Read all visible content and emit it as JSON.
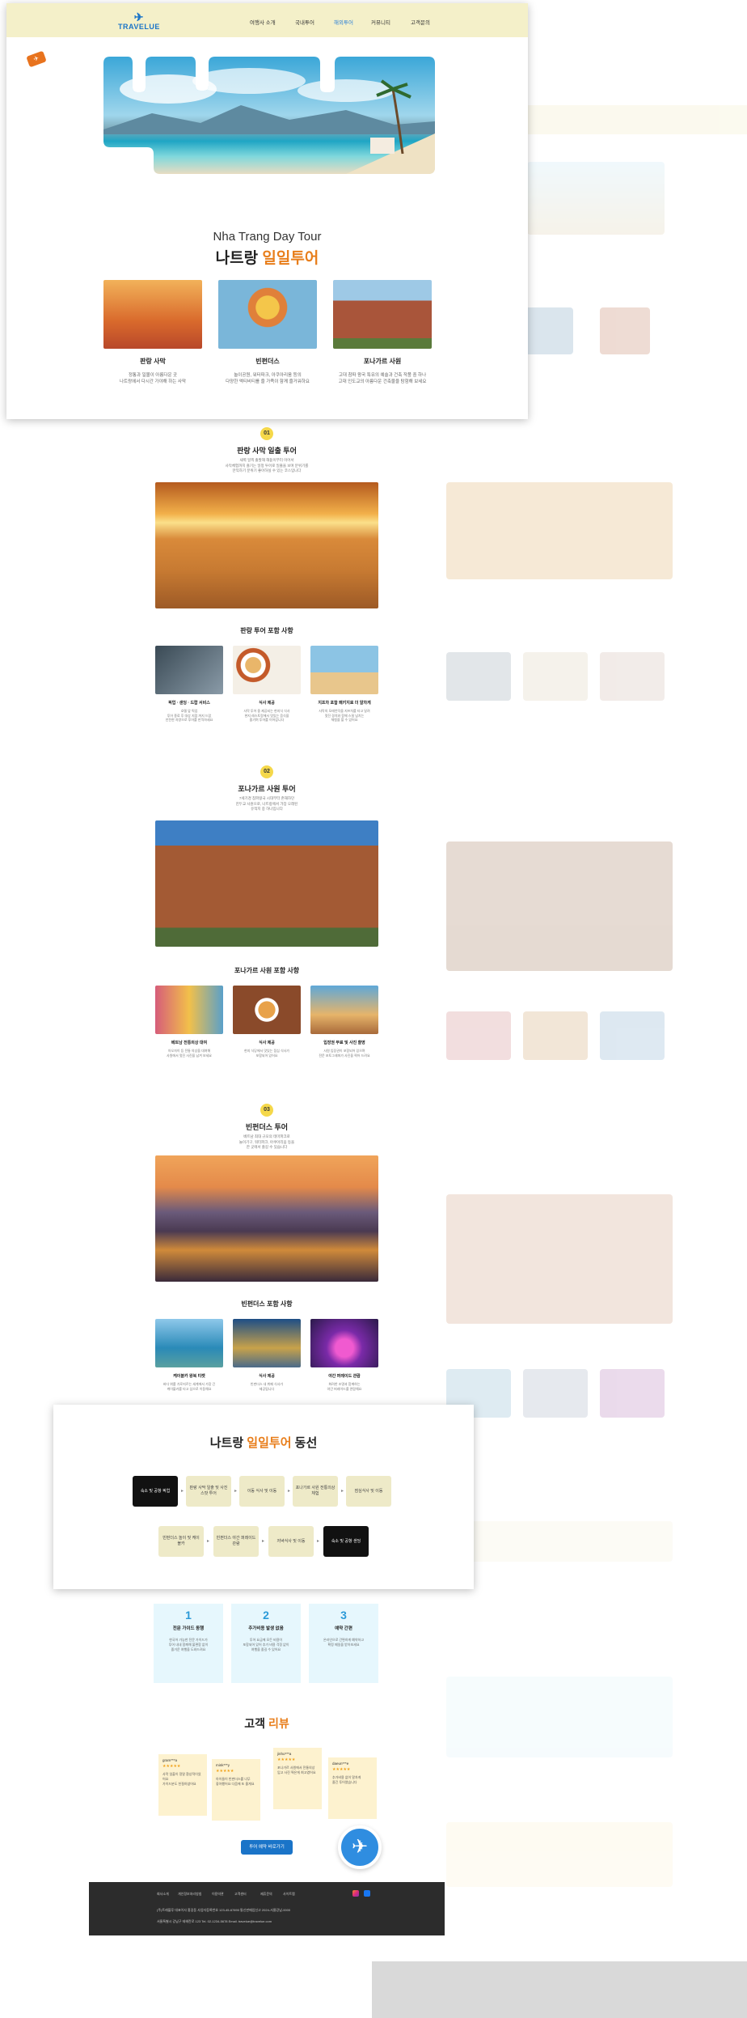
{
  "nav": {
    "logo": "TRAVELUE",
    "items": [
      "여행사 소개",
      "국내투어",
      "해외투어",
      "커뮤니티",
      "고객문의"
    ],
    "active_index": 2
  },
  "hero": {
    "title_en": "Nha Trang Day Tour",
    "title_ko_prefix": "나트랑 ",
    "title_ko_highlight": "일일투어"
  },
  "top_cards": [
    {
      "title": "판랑 사막",
      "desc": "정통과 일몰이 아름다운 곳\n나트랑에서 다시간 가야해 하는 사막"
    },
    {
      "title": "빈펀더스",
      "desc": "놀이공원, 워터파크, 아쿠아리움 등의\n다양한 엑티비티를 즐 가족이 함께 즐거워하요"
    },
    {
      "title": "포나가르 사원",
      "desc": "고대 참파 왕국 특유의 예술과 건축 작품 중 하나\n고대 인도교의 아름다운 건축물을 탐험해 보세요"
    }
  ],
  "sections": [
    {
      "num": "01",
      "title": "판랑 사막 일출 투어",
      "desc": "새벽 일찍 출발해 해돋이부터 이어서\n사막체험까지 즐기는 일정 투어로 일출을 보며 분위기를\n만끽하기 분위기 좋아하실 수 있는 코스입니다",
      "sub_title": "판랑 투어 포함 사항",
      "items": [
        {
          "title": "픽업 · 샌딩 · 드랍 서비스",
          "desc": "호텔 앞 픽업\n투어 종료 후 대상 지점 까지 드랍\n안전한 차량으로 투어를 만끽하세요"
        },
        {
          "title": "식사 제공",
          "desc": "사막 투어 중 제공되는 현지식 식사\n현지 레스토랑에서 맛있는 음식을\n즐기며 투어를 이어갑니다"
        },
        {
          "title": "지프차 포함 패키지로 더 알차게",
          "desc": "사막의 모래언덕을 지프차를 타고 달려\n멋진 경치와 함께 스릴 넘치는\n체험을 할 수 있어요"
        }
      ]
    },
    {
      "num": "02",
      "title": "포나가르 사원 투어",
      "desc": "7세기경 참파왕국 시대부터 존재하던\n힌두교 사원으로, 나트랑에서 가장 오래된\n유적지 중 하나입니다",
      "sub_title": "포나가르 사원 포함 사항",
      "items": [
        {
          "title": "베트남 전통의상 대여",
          "desc": "아오자이 등 전통 의상을 대여해\n사원에서 멋진 사진을 남겨 보세요"
        },
        {
          "title": "식사 제공",
          "desc": "현지 식당에서 맛있는 점심 식사가\n포함되어 있어요"
        },
        {
          "title": "입장권 무료 및 사진 촬영",
          "desc": "사원 입장권이 포함되어 있으며\n전문 포토그래퍼가 사진을 찍어 드려요"
        }
      ]
    },
    {
      "num": "03",
      "title": "빈펀더스 투어",
      "desc": "베트남 최대 규모의 테마파크로\n놀이기구, 워터파크, 아쿠아리움 등을\n한 곳에서 즐길 수 있습니다",
      "sub_title": "빈펀더스 포함 사항",
      "items": [
        {
          "title": "케이블카 왕복 티켓",
          "desc": "바다 위를 가로지르는 세계에서 가장 긴\n케이블카를 타고 섬으로 이동해요"
        },
        {
          "title": "식사 제공",
          "desc": "빈펀더스 내 뷔페 식사가\n제공됩니다"
        },
        {
          "title": "야간 퍼레이드 관람",
          "desc": "화려한 조명과 함께하는\n야간 퍼레이드를 관람해요"
        }
      ]
    }
  ],
  "route": {
    "title_prefix": "나트랑 ",
    "title_highlight": "일일투어",
    "title_suffix": " 동선",
    "row1": [
      "숙소 및 공항 픽업",
      "판랑 사막 일출 및 사진 스팟 투어",
      "이동 식사 및 이동",
      "포나가르 사원 전통의상 체험",
      "점심식사 및 이동"
    ],
    "row2": [
      "빈펀더스 놀이 및 케이블카",
      "빈펀더스 야간 퍼레이드 관람",
      "저녁식사 및 이동",
      "숙소 및 공항 샌딩"
    ]
  },
  "features": [
    {
      "num": "1",
      "title": "전문 가이드 동행",
      "desc": "한국어 가능한 전문 가이드가\n투어 내내 함께해 불편함 없이\n즐거운 여행을 도와드려요"
    },
    {
      "num": "2",
      "title": "추가비용 발생 없음",
      "desc": "투어 요금에 모든 비용이\n포함되어 있어 추가 비용 걱정 없이\n여행을 즐길 수 있어요"
    },
    {
      "num": "3",
      "title": "예약 간편",
      "desc": "온라인으로 간편하게 예약하고\n확정 메일을 받아보세요"
    }
  ],
  "reviews": {
    "title_prefix": "고객 ",
    "title_highlight": "리뷰",
    "items": [
      {
        "name": "gram***a",
        "stars": "★★★★★",
        "text": "사막 일출이 정말 환상적이었어요\n가이드분도 친절하셨어요"
      },
      {
        "name": "mink***y",
        "stars": "★★★★★",
        "text": "아이들이 빈펀더스를 너무\n좋아했어요 다음에 또 올게요"
      },
      {
        "name": "jinho***a",
        "stars": "★★★★★",
        "text": "포나가르 사원에서 전통의상\n입고 사진 찍은게 최고였어요"
      },
      {
        "name": "daeun***e",
        "stars": "★★★★★",
        "text": "추가비용 없이 알차게\n즐긴 투어였습니다"
      }
    ]
  },
  "cta": "투어 예약 바로가기",
  "footer": {
    "links": [
      "회사소개",
      "개인정보처리방침",
      "이용약관",
      "고객센터",
      "제휴문의",
      "사이트맵"
    ],
    "info1": "(주)트래블루   대표이사 홍길동   사업자등록번호 123-45-67890   통신판매업신고 2024-서울강남-0000",
    "info2": "서울특별시 강남구 테헤란로 123   Tel. 02-1234-5678   Email. travelue@travelue.com"
  },
  "colors": {
    "accent": "#e87e1b",
    "brand": "#1a74c8",
    "nav_bg": "#f4f0c9"
  }
}
